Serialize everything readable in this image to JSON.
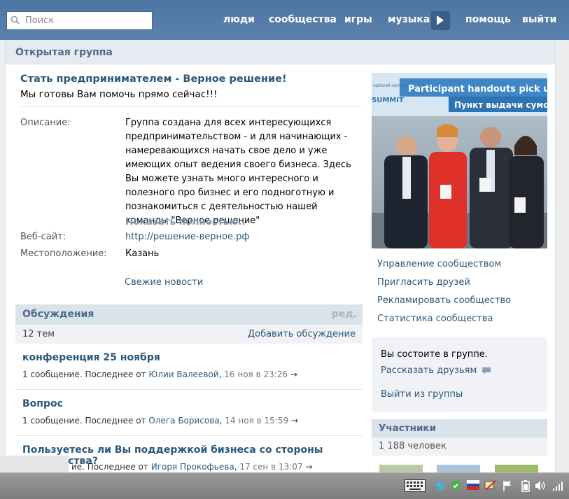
{
  "topbar": {
    "search_placeholder": "Поиск",
    "nav": [
      "люди",
      "сообщества",
      "игры",
      "музыка",
      "помощь",
      "выйти"
    ]
  },
  "group": {
    "header": "Открытая группа",
    "name": "Стать предпринимателем - Верное решение!",
    "status": "Мы готовы Вам помочь прямо сейчас!!!",
    "description_label": "Описание:",
    "description": "Группа создана для всех интересующихся предпринимательством - и для начинающих - намеревающихся начать свое дело и уже имеющих опыт ведения своего бизнеса. Здесь Вы можете узнать много интересного и полезного про бизнес и его подноготную и познакомиться с деятельностью нашей команды \"Верное решение\"",
    "show_more": "Показать полностью..",
    "website_label": "Веб-сайт:",
    "website": "http://решение-верное.рф",
    "location_label": "Местоположение:",
    "location": "Казань",
    "news_link": "Свежие новости"
  },
  "discussions": {
    "title": "Обсуждения",
    "edit": "ред.",
    "count": "12 тем",
    "add": "Добавить обсуждение",
    "topics": [
      {
        "title": "конференция 25 ноября",
        "prefix": "1 сообщение. Последнее от ",
        "author": "Юлии Валеевой",
        "date": "16 ноя в 23:26"
      },
      {
        "title": "Вопрос",
        "prefix": "1 сообщение. Последнее от ",
        "author": "Олега Борисова",
        "date": "14 ноя в 15:59"
      },
      {
        "title": "Пользуетесь ли Вы поддержкой бизнеса со стороны государства?",
        "prefix": "ие. Последнее от ",
        "author": "Игоря Прокофьева",
        "date": "17 сен в 13:07"
      }
    ]
  },
  "photo": {
    "banner1": "Participant handouts pick up",
    "banner2": "Пункт выдачи сумок",
    "brand": "SUMMIT",
    "brand_small": "national summit"
  },
  "actions": [
    "Управление сообществом",
    "Пригласить друзей",
    "Рекламировать сообщество",
    "Статистика сообщества"
  ],
  "membership": {
    "status": "Вы состоите в группе.",
    "tell_friends": "Рассказать друзьям",
    "leave": "Выйти из группы"
  },
  "participants": {
    "title": "Участники",
    "count": "1 188 человек"
  },
  "colors": {
    "topbar": "#557aa5",
    "link": "#2b587a",
    "header_text": "#4d6a8f"
  }
}
